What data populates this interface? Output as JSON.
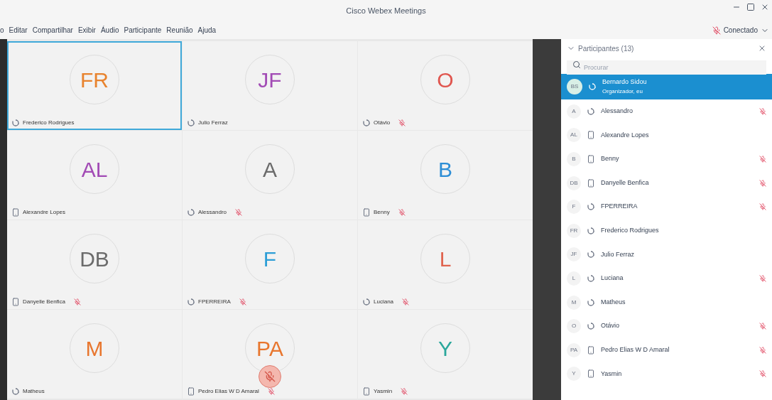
{
  "window": {
    "title": "Cisco Webex Meetings"
  },
  "menu": [
    "o",
    "Editar",
    "Compartilhar",
    "Exibir",
    "Áudio",
    "Participante",
    "Reunião",
    "Ajuda"
  ],
  "connection": {
    "label": "Conectado"
  },
  "tiles": [
    {
      "initials": "FR",
      "color": "#e8832e",
      "name": "Frederico Rodrigues",
      "kind": "computer",
      "muted": false,
      "selected": true,
      "speaking": false
    },
    {
      "initials": "JF",
      "color": "#a24bb5",
      "name": "Julio Ferraz",
      "kind": "computer",
      "muted": false,
      "selected": false,
      "speaking": false
    },
    {
      "initials": "O",
      "color": "#e0564f",
      "name": "Otávio",
      "kind": "computer",
      "muted": true,
      "selected": false,
      "speaking": false
    },
    {
      "initials": "AL",
      "color": "#a24bb5",
      "name": "Alexandre Lopes",
      "kind": "phone",
      "muted": false,
      "selected": false,
      "speaking": false
    },
    {
      "initials": "A",
      "color": "#6b6b6b",
      "name": "Alessandro",
      "kind": "computer",
      "muted": true,
      "selected": false,
      "speaking": false
    },
    {
      "initials": "B",
      "color": "#2d8ed6",
      "name": "Benny",
      "kind": "phone",
      "muted": true,
      "selected": false,
      "speaking": false
    },
    {
      "initials": "DB",
      "color": "#6b6b6b",
      "name": "Danyelle Benfica",
      "kind": "phone",
      "muted": true,
      "selected": false,
      "speaking": false
    },
    {
      "initials": "F",
      "color": "#2d9ed6",
      "name": "FPERREIRA",
      "kind": "computer",
      "muted": true,
      "selected": false,
      "speaking": false
    },
    {
      "initials": "L",
      "color": "#e0644f",
      "name": "Luciana",
      "kind": "computer",
      "muted": true,
      "selected": false,
      "speaking": false
    },
    {
      "initials": "M",
      "color": "#e8762e",
      "name": "Matheus",
      "kind": "computer",
      "muted": false,
      "selected": false,
      "speaking": false
    },
    {
      "initials": "PA",
      "color": "#e8762e",
      "name": "Pedro Elias W D Amaral",
      "kind": "phone",
      "muted": true,
      "selected": false,
      "speaking": true
    },
    {
      "initials": "Y",
      "color": "#2aa79b",
      "name": "Yasmin",
      "kind": "phone",
      "muted": true,
      "selected": false,
      "speaking": false
    }
  ],
  "panel": {
    "title": "Participantes (13)",
    "search": {
      "placeholder": "Procurar"
    },
    "participants": [
      {
        "initials": "BS",
        "name": "Bernardo Sidou",
        "role": "Organizador, eu",
        "kind": "computer",
        "muted": false,
        "selected": true
      },
      {
        "initials": "A",
        "name": "Alessandro",
        "kind": "computer",
        "muted": true,
        "selected": false
      },
      {
        "initials": "AL",
        "name": "Alexandre Lopes",
        "kind": "phone",
        "muted": false,
        "selected": false
      },
      {
        "initials": "B",
        "name": "Benny",
        "kind": "phone",
        "muted": true,
        "selected": false
      },
      {
        "initials": "DB",
        "name": "Danyelle Benfica",
        "kind": "phone",
        "muted": true,
        "selected": false
      },
      {
        "initials": "F",
        "name": "FPERREIRA",
        "kind": "computer",
        "muted": true,
        "selected": false
      },
      {
        "initials": "FR",
        "name": "Frederico Rodrigues",
        "kind": "computer",
        "muted": false,
        "selected": false
      },
      {
        "initials": "JF",
        "name": "Julio Ferraz",
        "kind": "computer",
        "muted": false,
        "selected": false
      },
      {
        "initials": "L",
        "name": "Luciana",
        "kind": "computer",
        "muted": true,
        "selected": false
      },
      {
        "initials": "M",
        "name": "Matheus",
        "kind": "computer",
        "muted": false,
        "selected": false
      },
      {
        "initials": "O",
        "name": "Otávio",
        "kind": "computer",
        "muted": true,
        "selected": false
      },
      {
        "initials": "PA",
        "name": "Pedro Elias W D Amaral",
        "kind": "phone",
        "muted": true,
        "selected": false
      },
      {
        "initials": "Y",
        "name": "Yasmin",
        "kind": "phone",
        "muted": true,
        "selected": false
      }
    ]
  }
}
